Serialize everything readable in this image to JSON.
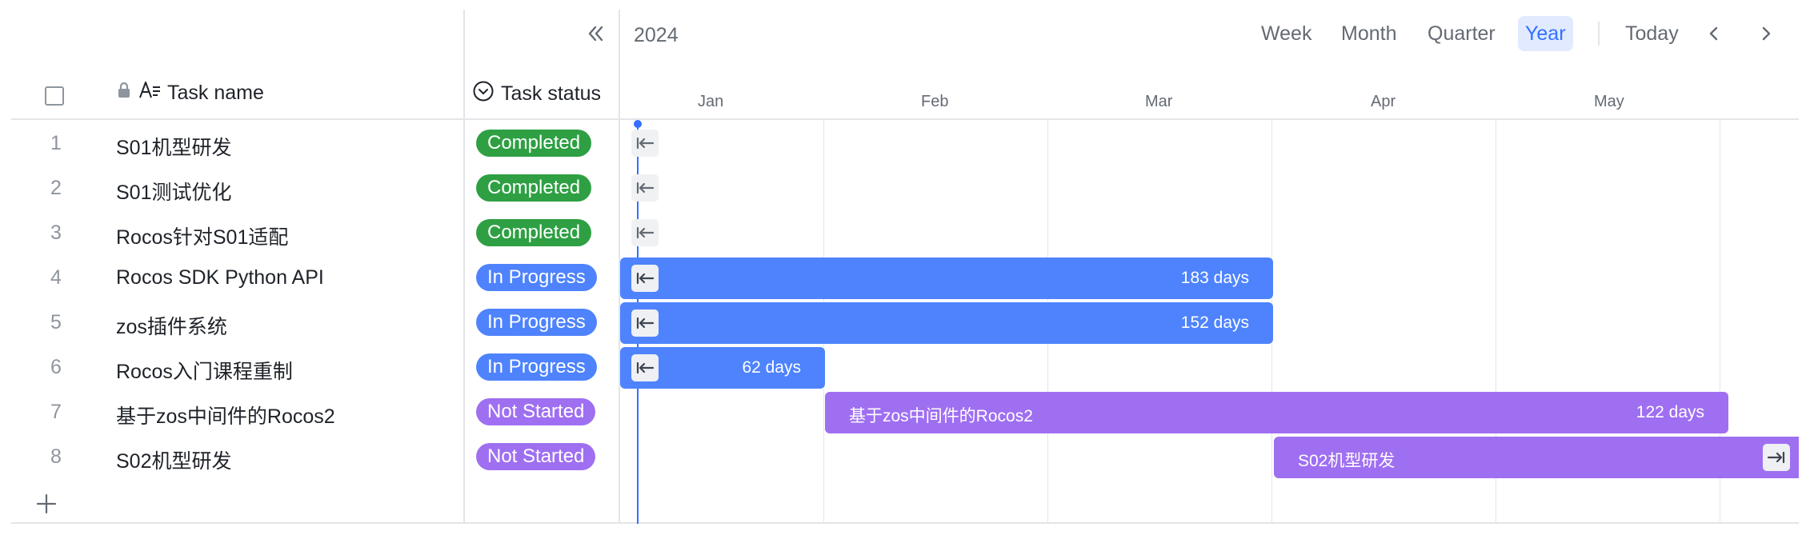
{
  "timeline": {
    "year": "2024",
    "views": [
      {
        "label": "Week",
        "active": false
      },
      {
        "label": "Month",
        "active": false
      },
      {
        "label": "Quarter",
        "active": false
      },
      {
        "label": "Year",
        "active": true
      }
    ],
    "today_label": "Today",
    "months": [
      "Jan",
      "Feb",
      "Mar",
      "Apr",
      "May"
    ]
  },
  "columns": {
    "task_name": "Task name",
    "task_status": "Task status"
  },
  "status_colors": {
    "Completed": "#2ea043",
    "In Progress": "#4e83fd",
    "Not Started": "#9f6ff1"
  },
  "tasks": [
    {
      "num": "1",
      "name": "S01机型研发",
      "status": "Completed"
    },
    {
      "num": "2",
      "name": "S01测试优化",
      "status": "Completed"
    },
    {
      "num": "3",
      "name": "Rocos针对S01适配",
      "status": "Completed"
    },
    {
      "num": "4",
      "name": "Rocos SDK Python API",
      "status": "In Progress",
      "duration": "183 days"
    },
    {
      "num": "5",
      "name": "zos插件系统",
      "status": "In Progress",
      "duration": "152 days"
    },
    {
      "num": "6",
      "name": "Rocos入门课程重制",
      "status": "In Progress",
      "duration": "62 days"
    },
    {
      "num": "7",
      "name": "基于zos中间件的Rocos2",
      "status": "Not Started",
      "duration": "122 days",
      "bar_label": "基于zos中间件的Rocos2"
    },
    {
      "num": "8",
      "name": "S02机型研发",
      "status": "Not Started",
      "bar_label": "S02机型研发"
    }
  ]
}
